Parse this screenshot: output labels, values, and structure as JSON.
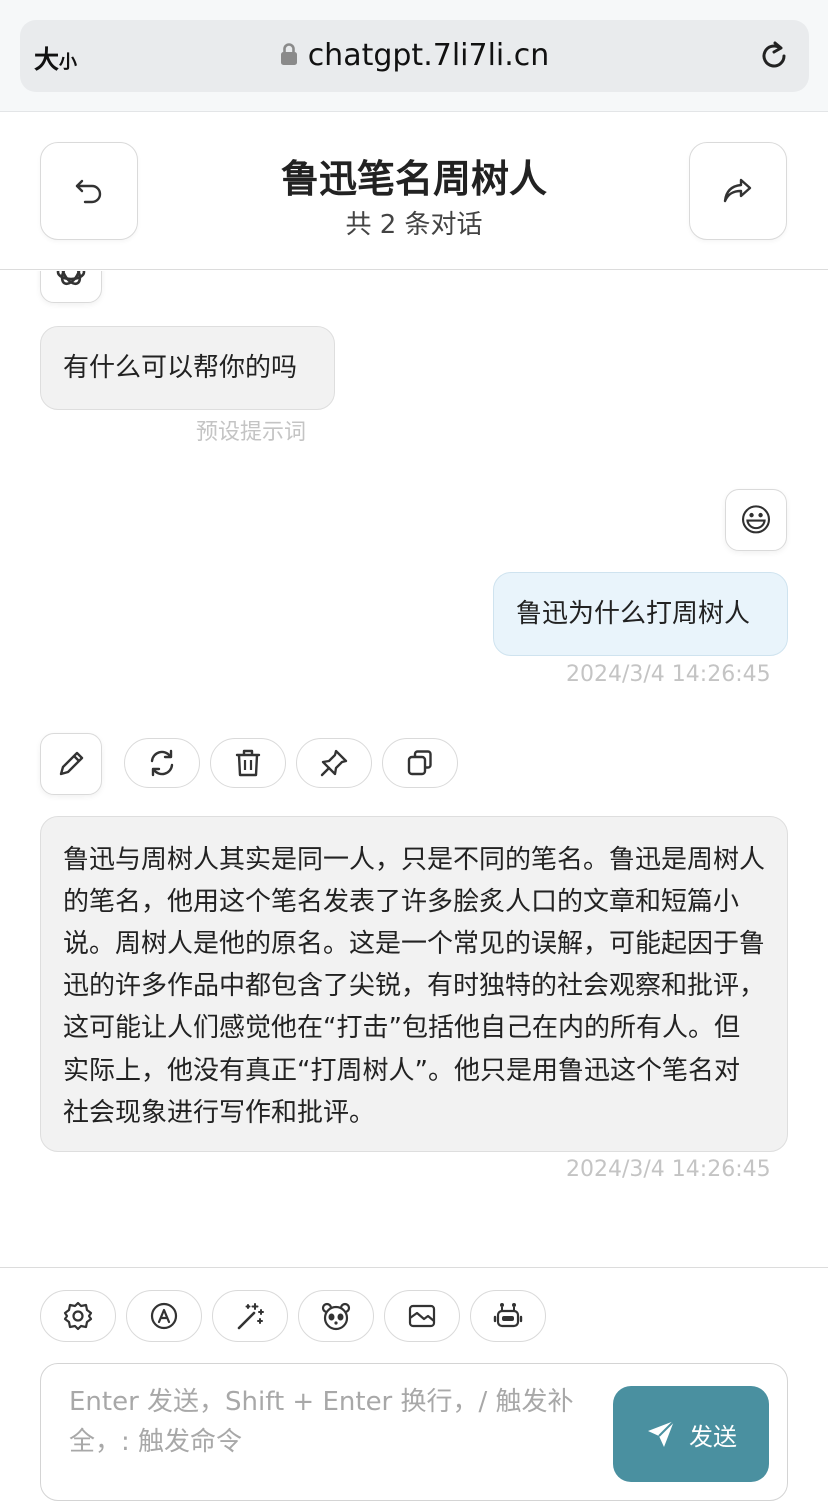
{
  "browser": {
    "text_size_big": "大",
    "text_size_small": "小",
    "url": "chatgpt.7li7li.cn"
  },
  "header": {
    "title": "鲁迅笔名周树人",
    "subtitle": "共 2 条对话"
  },
  "messages": [
    {
      "role": "assistant",
      "text": "有什么可以帮你的吗",
      "meta": "预设提示词"
    },
    {
      "role": "user",
      "avatar_emoji": "😃",
      "text": "鲁迅为什么打周树人",
      "meta": "2024/3/4 14:26:45"
    },
    {
      "role": "assistant",
      "text": "鲁迅与周树人其实是同一人，只是不同的笔名。鲁迅是周树人的笔名，他用这个笔名发表了许多脍炙人口的文章和短篇小说。周树人是他的原名。这是一个常见的误解，可能起因于鲁迅的许多作品中都包含了尖锐，有时独特的社会观察和批评，这可能让人们感觉他在“打击”包括他自己在内的所有人。但实际上，他没有真正“打周树人”。他只是用鲁迅这个笔名对社会现象进行写作和批评。",
      "meta": "2024/3/4 14:26:45"
    }
  ],
  "message_actions": [
    "edit-icon",
    "refresh-icon",
    "delete-icon",
    "pin-icon",
    "copy-icon"
  ],
  "toolbar_icons": [
    "settings-icon",
    "theme-icon",
    "prompt-magic-icon",
    "mask-icon",
    "image-icon",
    "robot-icon"
  ],
  "input": {
    "placeholder": "Enter 发送，Shift + Enter 换行，/ 触发补全，: 触发命令",
    "value": "",
    "send_label": "发送"
  },
  "colors": {
    "send_button": "#4a90a0",
    "user_bubble": "#e9f4fb",
    "bot_bubble": "#f2f2f2"
  }
}
